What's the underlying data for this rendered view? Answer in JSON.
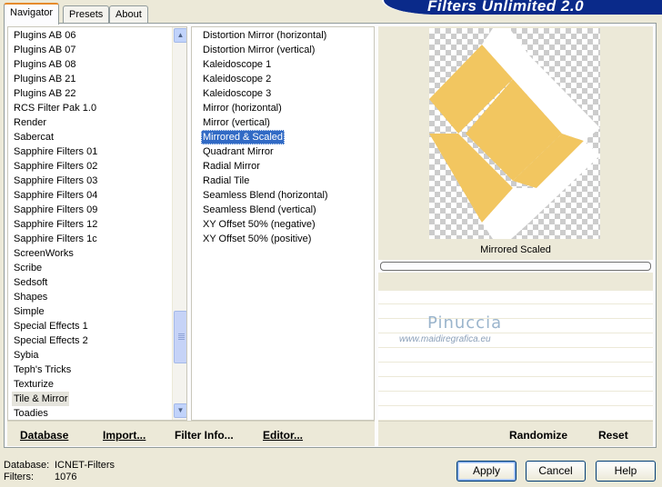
{
  "banner": {
    "title": "Filters Unlimited 2.0"
  },
  "tabs": [
    {
      "label": "Navigator",
      "active": true
    },
    {
      "label": "Presets",
      "active": false
    },
    {
      "label": "About",
      "active": false
    }
  ],
  "categories": {
    "items": [
      "Plugins AB 06",
      "Plugins AB 07",
      "Plugins AB 08",
      "Plugins AB 21",
      "Plugins AB 22",
      "RCS Filter Pak 1.0",
      "Render",
      "Sabercat",
      "Sapphire Filters 01",
      "Sapphire Filters 02",
      "Sapphire Filters 03",
      "Sapphire Filters 04",
      "Sapphire Filters 09",
      "Sapphire Filters 12",
      "Sapphire Filters 1c",
      "ScreenWorks",
      "Scribe",
      "Sedsoft",
      "Shapes",
      "Simple",
      "Special Effects 1",
      "Special Effects 2",
      "Sybia",
      "Teph's Tricks",
      "Texturize",
      "Tile & Mirror",
      "Toadies"
    ],
    "selected": "Tile & Mirror",
    "scroll_up_icon": "arrow-up-icon",
    "scroll_down_icon": "arrow-down-icon"
  },
  "filters": {
    "items": [
      "Distortion Mirror (horizontal)",
      "Distortion Mirror (vertical)",
      "Kaleidoscope 1",
      "Kaleidoscope 2",
      "Kaleidoscope 3",
      "Mirror (horizontal)",
      "Mirror (vertical)",
      "Mirrored & Scaled",
      "Quadrant Mirror",
      "Radial Mirror",
      "Radial Tile",
      "Seamless Blend (horizontal)",
      "Seamless Blend (vertical)",
      "XY Offset 50% (negative)",
      "XY Offset 50% (positive)"
    ],
    "selected": "Mirrored & Scaled"
  },
  "left_toolbar": {
    "database": "Database",
    "import": "Import...",
    "filter_info": "Filter Info...",
    "editor": "Editor..."
  },
  "preview": {
    "filter_name": "Mirrored  Scaled",
    "shape_color": "#f2c660",
    "randomize": "Randomize",
    "reset": "Reset"
  },
  "watermark": {
    "name": "Pinuccia",
    "url": "www.maidiregrafica.eu"
  },
  "status": {
    "database_label": "Database:",
    "database_value": "ICNET-Filters",
    "filters_label": "Filters:",
    "filters_value": "1076"
  },
  "dialog": {
    "apply": "Apply",
    "cancel": "Cancel",
    "help": "Help"
  },
  "colors": {
    "selection": "#316ac5",
    "banner": "#0a2a8a",
    "tab_accent": "#e68b2c"
  }
}
